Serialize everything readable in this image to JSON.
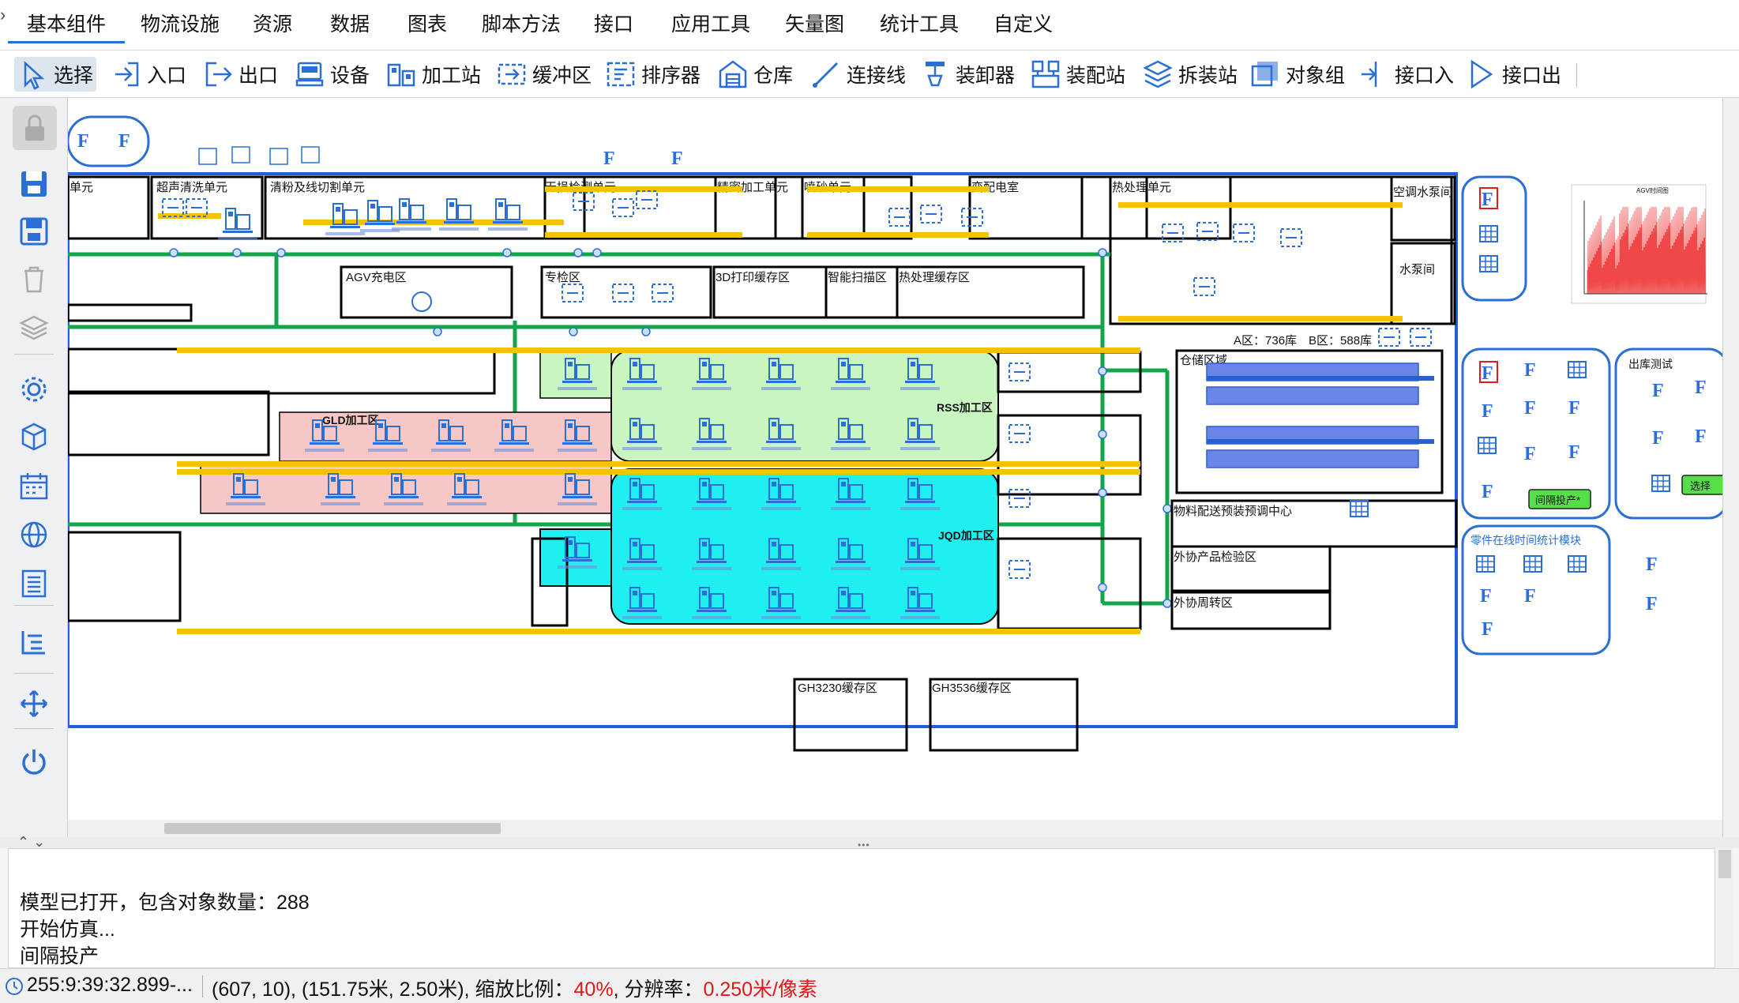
{
  "menu": {
    "tabs": [
      "基本组件",
      "物流设施",
      "资源",
      "数据",
      "图表",
      "脚本方法",
      "接口",
      "应用工具",
      "矢量图",
      "统计工具",
      "自定义"
    ],
    "active_index": 0
  },
  "toolbar": {
    "tools": [
      {
        "label": "选择",
        "icon": "cursor-arrow-icon"
      },
      {
        "label": "入口",
        "icon": "entrance-arrow-icon"
      },
      {
        "label": "出口",
        "icon": "exit-arrow-icon"
      },
      {
        "label": "设备",
        "icon": "equipment-icon"
      },
      {
        "label": "加工站",
        "icon": "processing-station-icon"
      },
      {
        "label": "缓冲区",
        "icon": "buffer-icon"
      },
      {
        "label": "排序器",
        "icon": "sorter-icon"
      },
      {
        "label": "仓库",
        "icon": "warehouse-icon"
      },
      {
        "label": "连接线",
        "icon": "connector-line-icon"
      },
      {
        "label": "装卸器",
        "icon": "loader-unloader-icon"
      },
      {
        "label": "装配站",
        "icon": "assembly-station-icon"
      },
      {
        "label": "拆装站",
        "icon": "disassembly-station-icon"
      },
      {
        "label": "对象组",
        "icon": "object-group-icon"
      },
      {
        "label": "接口入",
        "icon": "interface-in-icon"
      },
      {
        "label": "接口出",
        "icon": "interface-out-icon"
      }
    ],
    "selected_index": 0
  },
  "sidebar": {
    "icons": [
      "lock-icon",
      "save-icon",
      "save-as-icon",
      "trash-icon",
      "layers-icon",
      "gear-icon",
      "cube-icon",
      "calendar-icon",
      "globe-icon",
      "list-icon",
      "tree-list-icon",
      "move-arrows-icon",
      "power-icon"
    ]
  },
  "canvas": {
    "labels": {
      "unit_short": "单元",
      "degrease": "超声清洗单元",
      "cut": "清粉及线切割单元",
      "inspect": "无损检测单元",
      "precision": "精密加工单元",
      "sandblast": "喷砂单元",
      "power_room": "变配电室",
      "heat": "热处理单元",
      "ac_pump": "空调水泵间",
      "pump": "水泵间",
      "agv_charge": "AGV充电区",
      "special": "专检区",
      "print3d": "3D打印缓存区",
      "scan": "智能扫描区",
      "heat_buffer": "热处理缓存区",
      "rss": "RSS加工区",
      "gld": "GLD加工区",
      "jqd": "JQD加工区",
      "storage": "仓储区域",
      "storage_stats": "A区：736库　B区：588库",
      "material": "物料配送预装预调中心",
      "outsource_inspect": "外协产品检验区",
      "outsource_turn": "外协周转区",
      "gh3230": "GH3230缓存区",
      "gh3536": "GH3536缓存区",
      "outbound_test": "出库测试",
      "online_stats": "零件在线时间统计模块",
      "interval_btn": "间隔投产*",
      "select_btn": "选择",
      "chart_title": "AGV时间图"
    }
  },
  "log": {
    "lines": [
      "模型已打开，包含对象数量：288",
      "开始仿真...",
      "间隔投产"
    ]
  },
  "status": {
    "time": "255:9:39:32.899-...",
    "coords": "(607, 10), (151.75米, 2.50米), 缩放比例：",
    "zoom": "40%",
    "res_label": ", 分辨率：",
    "resolution": "0.250米/像素"
  },
  "colors": {
    "accent": "#2b6fd6",
    "conveyor_green": "#12a64a",
    "track_yellow": "#f5c200",
    "rss_zone": "#c9f5c0",
    "gld_zone": "#f7c7c7",
    "jqd_zone": "#1ef0f2",
    "log_red": "#e0181a"
  }
}
